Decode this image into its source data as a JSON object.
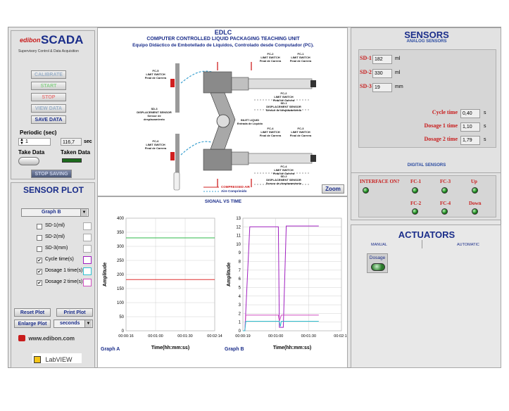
{
  "logo": {
    "brand": "edibon",
    "product": "SCADA",
    "tagline": "Supervisory Control & Data Acquisition"
  },
  "controls": {
    "calibrate": "CALIBRATE",
    "start": "START",
    "stop": "STOP",
    "view_data": "VIEW DATA",
    "save_data": "SAVE DATA",
    "periodic_label": "Periodic (sec)",
    "periodic_value": "1",
    "elapsed_value": "116,7",
    "elapsed_unit": "sec",
    "take_data": "Take Data",
    "taken_data": "Taken Data",
    "stop_saving": "STOP SAVING"
  },
  "diagram": {
    "title": "EDLC",
    "subtitle1": "COMPUTER CONTROLLED LIQUID PACKAGING TEACHING UNIT",
    "subtitle2": "Equipo Didáctico de Embotellado de Líquidos, Controlado desde Computador (PC).",
    "zoom": "Zoom",
    "legend_air": "COMPRESSED AIR",
    "legend_air_es": "Aire Comprimido",
    "labels": [
      {
        "id": "fc5",
        "text": "FC-5\nLIMIT SWITCH\nFinal de Carrera"
      },
      {
        "id": "sd3",
        "text": "SD-3\nDISPLACEMENT SENSOR\nSensor de desplazamiento"
      },
      {
        "id": "fc6",
        "text": "FC-6\nLIMIT SWITCH\nFinal de Carrera"
      },
      {
        "id": "fc2a",
        "text": "FC-2\nLIMIT SWITCH\nFinal de Carrera"
      },
      {
        "id": "fc1",
        "text": "FC-1\nLIMIT SWITCH\nFinal de Carrera"
      },
      {
        "id": "fc2b",
        "text": "FC-2\nLIMIT SWITCH\nFinal de Carrera"
      },
      {
        "id": "sd1",
        "text": "SD-1\nDISPLACEMENT SENSOR\nSensor de desplazamiento"
      },
      {
        "id": "inlet",
        "text": "INLET LIQUID\nEntrada de Líquido"
      },
      {
        "id": "fc4a",
        "text": "FC-4\nLIMIT SWITCH\nFinal de Carrera"
      },
      {
        "id": "fc3",
        "text": "FC-3\nLIMIT SWITCH\nFinal de Carrera"
      },
      {
        "id": "fc4b",
        "text": "FC-4\nLIMIT SWITCH\nFinal de Carrera"
      },
      {
        "id": "sd2",
        "text": "SD-2\nDISPLACEMENT SENSOR\nSensor de desplazamiento"
      }
    ]
  },
  "sensors": {
    "title": "SENSORS",
    "subtitle": "ANALOG SENSORS",
    "analog": [
      {
        "label": "SD-1",
        "value": "182",
        "unit": "ml"
      },
      {
        "label": "SD-2",
        "value": "330",
        "unit": "ml"
      },
      {
        "label": "SD-3",
        "value": "19",
        "unit": "mm"
      }
    ],
    "times": [
      {
        "label": "Cycle time",
        "value": "0,40",
        "unit": "s"
      },
      {
        "label": "Dosage 1 time",
        "value": "1,10",
        "unit": "s"
      },
      {
        "label": "Dosage 2 time",
        "value": "1,79",
        "unit": "s"
      }
    ],
    "digital_title": "DIGITAL SENSORS",
    "interface": "INTERFACE ON?",
    "digital": [
      "FC-1",
      "FC-3",
      "Up",
      "FC-2",
      "FC-4",
      "Down"
    ]
  },
  "actuators": {
    "title": "ACTUATORS",
    "tab_manual": "MANUAL",
    "tab_auto": "AUTOMATIC",
    "dosage": "Dosage"
  },
  "plot": {
    "title": "SENSOR PLOT",
    "signal_title": "SIGNAL VS TIME",
    "graph_select": "Graph B",
    "legend": [
      {
        "label": "SD-1(ml)",
        "checked": false
      },
      {
        "label": "SD-2(ml)",
        "checked": false
      },
      {
        "label": "SD-3(mm)",
        "checked": false
      },
      {
        "label": "Cycle time(s)",
        "checked": true
      },
      {
        "label": "Dosage 1 time(s)",
        "checked": true
      },
      {
        "label": "Dosage 2 time(s)",
        "checked": true
      }
    ],
    "reset_plot": "Reset Plot",
    "print_plot": "Print Plot",
    "enlarge_plot": "Enlarge Plot",
    "units_select": "seconds",
    "website": "www.edibon.com",
    "labview": "LabVIEW"
  },
  "chart_data": [
    {
      "type": "line",
      "title": "Graph A",
      "xlabel": "Time(hh:mm:ss)",
      "ylabel": "Amplitude",
      "ylim": [
        0,
        400
      ],
      "yticks": [
        "0",
        "50",
        "100",
        "150",
        "200",
        "250",
        "300",
        "350",
        "400"
      ],
      "xticks": [
        "00:00:16",
        "00:01:00",
        "00:01:30",
        "00:02:14"
      ],
      "series": [
        {
          "color": "#2fb84a",
          "x": [
            0,
            1
          ],
          "values": [
            330,
            330
          ]
        },
        {
          "color": "#e03030",
          "x": [
            0,
            1
          ],
          "values": [
            182,
            182
          ]
        }
      ]
    },
    {
      "type": "line",
      "title": "Graph B",
      "xlabel": "Time(hh:mm:ss)",
      "ylabel": "Amplitude",
      "ylim": [
        0,
        13
      ],
      "yticks": [
        "0",
        "1",
        "2",
        "3",
        "4",
        "5",
        "6",
        "7",
        "8",
        "9",
        "10",
        "11",
        "12",
        "13"
      ],
      "xticks": [
        "00:00:19",
        "00:01:00",
        "00:01:30",
        "00:02:17"
      ],
      "series": [
        {
          "color": "#a020c0",
          "x": [
            0,
            0.02,
            0.07,
            0.36,
            0.37,
            0.41,
            0.44,
            0.48,
            0.77
          ],
          "values": [
            0,
            0,
            12,
            12,
            0.4,
            0.4,
            12.1,
            12.1,
            12.1
          ]
        },
        {
          "color": "#d050c0",
          "x": [
            0,
            0.02,
            0.03,
            0.36,
            0.37,
            0.39,
            0.77
          ],
          "values": [
            0,
            0,
            1.8,
            1.8,
            1.1,
            1.8,
            1.8
          ]
        },
        {
          "color": "#30c0d0",
          "x": [
            0,
            0.02,
            0.03,
            0.37,
            0.38,
            0.39,
            0.77
          ],
          "values": [
            0,
            0,
            1.1,
            1.1,
            0.5,
            1.1,
            1.1
          ]
        }
      ]
    }
  ]
}
